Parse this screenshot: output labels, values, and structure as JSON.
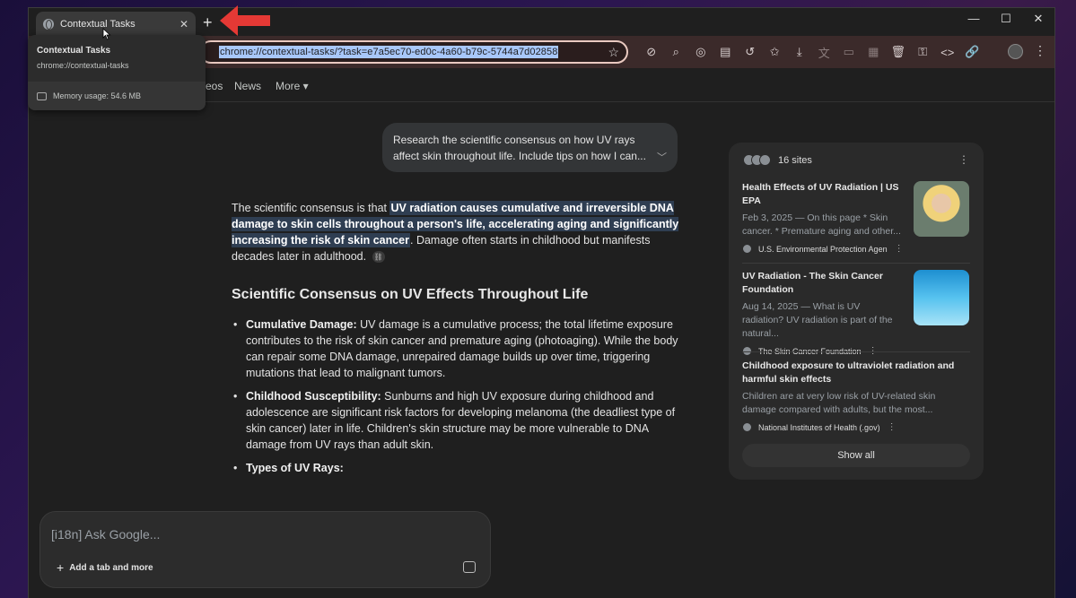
{
  "browser": {
    "tab_title": "Contextual Tasks",
    "tab_close": "✕",
    "new_tab": "+",
    "window_controls": {
      "minimize": "—",
      "maximize": "☐",
      "close": "✕"
    },
    "url": "chrome://contextual-tasks/?task=e7a5ec70-ed0c-4a60-b79c-5744a7d02858",
    "url_prefix_fragment": "e",
    "star": "☆"
  },
  "hovercard": {
    "title": "Contextual Tasks",
    "url": "chrome://contextual-tasks",
    "memory": "Memory usage: 54.6 MB"
  },
  "nav": {
    "videos": "eos",
    "news": "News",
    "more": "More ▾"
  },
  "chat": {
    "user_prompt_line1": "Research the scientific consensus on how UV rays",
    "user_prompt_line2": "affect skin throughout life. Include tips on how I can...",
    "answer_intro_start": "The scientific consensus is that ",
    "answer_highlight": "UV radiation causes cumulative and irreversible DNA damage to skin cells throughout a person's life, accelerating aging and significantly increasing the risk of skin cancer",
    "answer_intro_end": ". Damage often starts in childhood but manifests decades later in adulthood.",
    "section_heading": "Scientific Consensus on UV Effects Throughout Life",
    "bullets": [
      {
        "label": "Cumulative Damage:",
        "text": " UV damage is a cumulative process; the total lifetime exposure contributes to the risk of skin cancer and premature aging (photoaging). While the body can repair some DNA damage, unrepaired damage builds up over time, triggering mutations that lead to malignant tumors."
      },
      {
        "label": "Childhood Susceptibility:",
        "text": " Sunburns and high UV exposure during childhood and adolescence are significant risk factors for developing melanoma (the deadliest type of skin cancer) later in life. Children's skin structure may be more vulnerable to DNA damage from UV rays than adult skin."
      },
      {
        "label": "Types of UV Rays:",
        "text": ""
      }
    ],
    "input_placeholder": "[i18n] Ask Google...",
    "add_tab_label": "Add a tab and more"
  },
  "sources": {
    "count_label": "16 sites",
    "items": [
      {
        "title": "Health Effects of UV Radiation | US EPA",
        "snippet": "Feb 3, 2025 — On this page * Skin cancer. * Premature aging and other...",
        "source": "U.S. Environmental Protection Agen"
      },
      {
        "title": "UV Radiation - The Skin Cancer Foundation",
        "snippet": "Aug 14, 2025 — What is UV radiation? UV radiation is part of the natural...",
        "source": "The Skin Cancer Foundation"
      },
      {
        "title": "Childhood exposure to ultraviolet radiation and harmful skin effects",
        "snippet": "Children are at very low risk of UV-related skin damage compared with adults, but the most...",
        "source": "National Institutes of Health (.gov)"
      }
    ],
    "show_all": "Show all"
  },
  "colors": {
    "toolbar_bg": "#3b2a2a",
    "url_highlight": "#a8c7fa",
    "answer_highlight_bg": "#2f3e52",
    "annotation_arrow": "#e53935"
  }
}
